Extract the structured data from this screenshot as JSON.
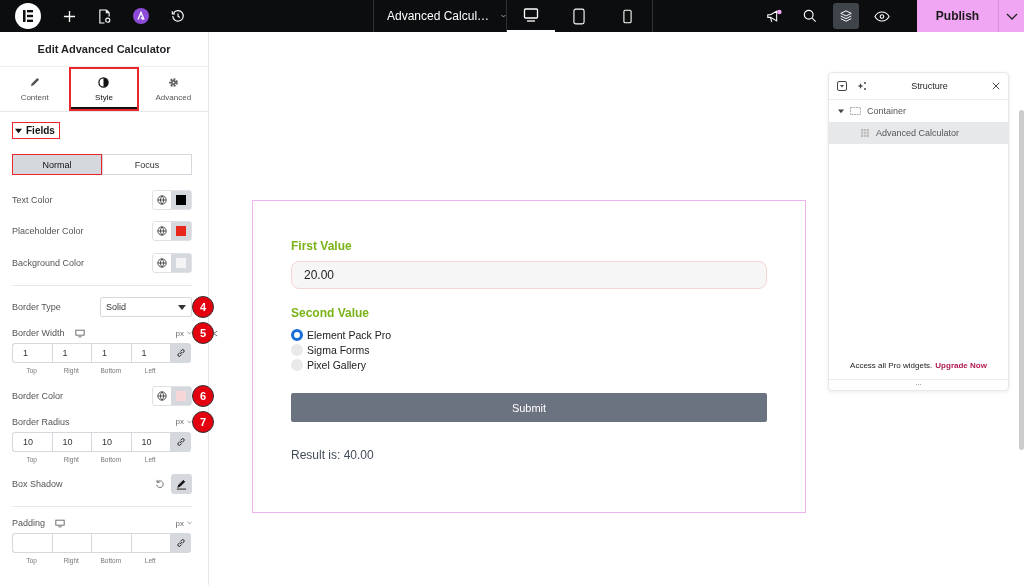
{
  "topbar": {
    "document_title": "Advanced Calcul…",
    "devices": [
      {
        "kind": "desktop",
        "selected": true
      },
      {
        "kind": "tablet",
        "selected": false
      },
      {
        "kind": "mobile",
        "selected": false
      }
    ],
    "structure_toggle": {
      "selected": true
    },
    "notification": {
      "on": true
    },
    "publish": "Publish"
  },
  "panel": {
    "title": "Edit Advanced Calculator",
    "tabs": [
      {
        "kind": "content",
        "label": "Content",
        "selected": false,
        "highlighted": false
      },
      {
        "kind": "style",
        "label": "Style",
        "selected": true,
        "highlighted": true
      },
      {
        "kind": "advanced",
        "label": "Advanced",
        "selected": false,
        "highlighted": false
      }
    ],
    "section": {
      "label": "Fields",
      "expanded": true,
      "highlighted": true
    },
    "state_tabs": [
      {
        "label": "Normal",
        "selected": true,
        "highlighted": true
      },
      {
        "label": "Focus",
        "selected": false,
        "highlighted": false
      }
    ],
    "controls": [
      {
        "kind": "color",
        "label": "Text Color",
        "color": "#000000"
      },
      {
        "kind": "color",
        "label": "Placeholder Color",
        "color": "#e8261c"
      },
      {
        "kind": "color",
        "label": "Background Color",
        "color": "#f4f4f4"
      },
      {
        "kind": "divider"
      },
      {
        "kind": "select",
        "label": "Border Type",
        "value": "Solid",
        "callout": "4"
      },
      {
        "kind": "dimensions",
        "label": "Border Width",
        "responsive": true,
        "unit": "px",
        "callout": "5",
        "values": [
          "1",
          "1",
          "1",
          "1"
        ],
        "sides": [
          "Top",
          "Right",
          "Bottom",
          "Left"
        ]
      },
      {
        "kind": "color",
        "label": "Border Color",
        "color": "#f6d6d6",
        "callout": "6"
      },
      {
        "kind": "dimensions",
        "label": "Border Radius",
        "responsive": false,
        "unit": "px",
        "callout": "7",
        "values": [
          "10",
          "10",
          "10",
          "10"
        ],
        "sides": [
          "Top",
          "Right",
          "Bottom",
          "Left"
        ]
      },
      {
        "kind": "shadow",
        "label": "Box Shadow"
      },
      {
        "kind": "divider"
      },
      {
        "kind": "dimensions",
        "label": "Padding",
        "responsive": true,
        "unit": "px",
        "sides": [
          "Top",
          "Right",
          "Bottom",
          "Left"
        ]
      }
    ]
  },
  "form": {
    "first": {
      "label": "First Value",
      "value": "20.00"
    },
    "second": {
      "label": "Second Value",
      "options": [
        {
          "label": "Element Pack Pro",
          "selected": true
        },
        {
          "label": "Sigma Forms",
          "selected": false
        },
        {
          "label": "Pixel Gallery",
          "selected": false
        }
      ]
    },
    "submit": "Submit",
    "result": "Result is: 40.00"
  },
  "structure": {
    "title": "Structure",
    "tree": [
      {
        "label": "Container",
        "expanded": true,
        "selected": false,
        "children": [
          {
            "label": "Advanced Calculator",
            "selected": true
          }
        ]
      }
    ],
    "promo": "Access all Pro widgets.",
    "promo_link": "Upgrade Now",
    "footer": "..."
  }
}
